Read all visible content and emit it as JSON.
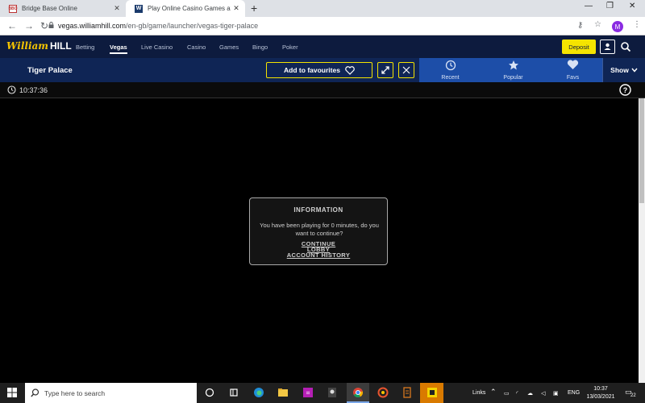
{
  "browser": {
    "tabs": [
      {
        "title": "Bridge Base Online",
        "favicon": "BBO",
        "close": "✕"
      },
      {
        "title": "Play Online Casino Games at Wil",
        "favicon": "W",
        "close": "✕"
      }
    ],
    "new_tab": "+",
    "url": {
      "host": "vegas.williamhill.com",
      "path": "/en-gb/game/launcher/vegas-tiger-palace"
    },
    "profile_initial": "M"
  },
  "site": {
    "logo_script": "William",
    "logo_block": "HILL",
    "nav": [
      "Betting",
      "Vegas",
      "Live Casino",
      "Casino",
      "Games",
      "Bingo",
      "Poker"
    ],
    "deposit_label": "Deposit"
  },
  "game_header": {
    "title": "Tiger Palace",
    "favourite_label": "Add to favourites",
    "quick": [
      {
        "label": "Recent",
        "icon": "clock-icon"
      },
      {
        "label": "Popular",
        "icon": "star-icon"
      },
      {
        "label": "Favs",
        "icon": "heart-icon"
      }
    ],
    "show_label": "Show"
  },
  "session": {
    "time": "10:37:36"
  },
  "modal": {
    "title": "INFORMATION",
    "message": "You have been playing for 0 minutes, do you want to continue?",
    "continue": "CONTINUE",
    "lobby": "LOBBY",
    "history": "ACCOUNT HISTORY"
  },
  "taskbar": {
    "search_placeholder": "Type here to search",
    "links_label": "Links",
    "lang": "ENG",
    "time": "10:37",
    "date": "13/03/2021",
    "notifications": "22"
  },
  "colors": {
    "brand_navy": "#0d1b3e",
    "quick_blue": "#1d4ea8",
    "deposit_yellow": "#f5e400"
  }
}
